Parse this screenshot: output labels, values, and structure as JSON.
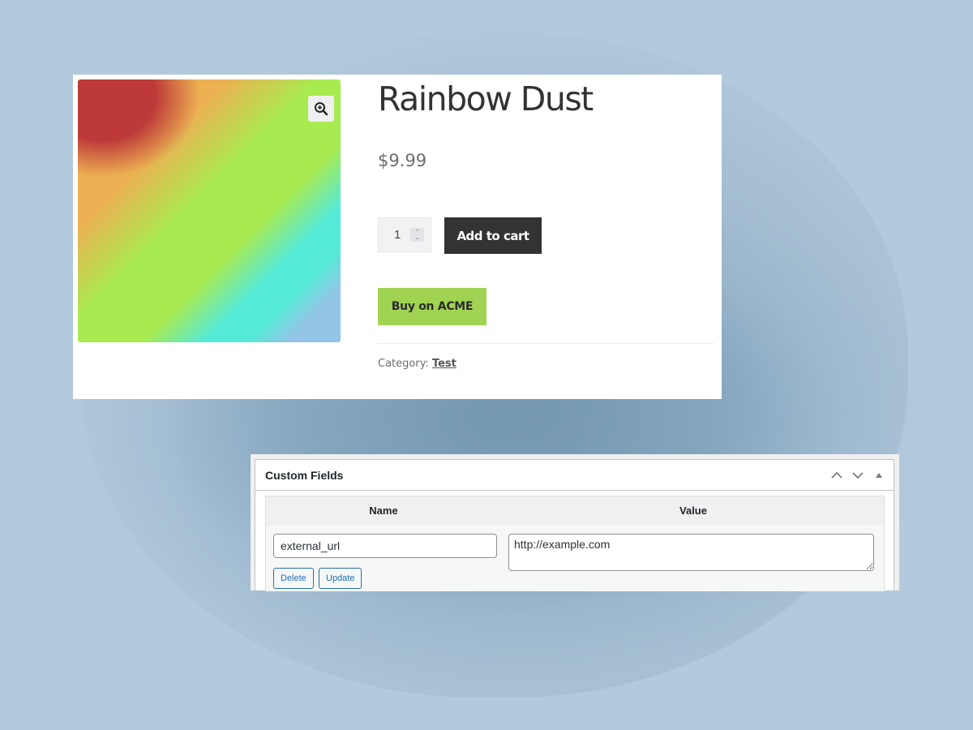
{
  "product": {
    "title": "Rainbow Dust",
    "price": "$9.99",
    "quantity": "1",
    "add_to_cart_label": "Add to cart",
    "external_button_label": "Buy on ACME",
    "category_label": "Category:",
    "category_value": "Test",
    "image_icon": "zoom-in-icon",
    "colors": {
      "add_to_cart_bg": "#333333",
      "external_button_bg": "#a1d353",
      "image_gradient": [
        "#bd3a39",
        "#ecb052",
        "#a8eb50",
        "#55ead8",
        "#94c5e6"
      ]
    }
  },
  "custom_fields": {
    "title": "Custom Fields",
    "controls": [
      "move-up-icon",
      "move-down-icon",
      "toggle-panel-icon"
    ],
    "columns": [
      "Name",
      "Value"
    ],
    "rows": [
      {
        "name": "external_url",
        "value": "http://example.com",
        "delete_label": "Delete",
        "update_label": "Update"
      }
    ],
    "colors": {
      "button_accent": "#2271b1"
    }
  }
}
